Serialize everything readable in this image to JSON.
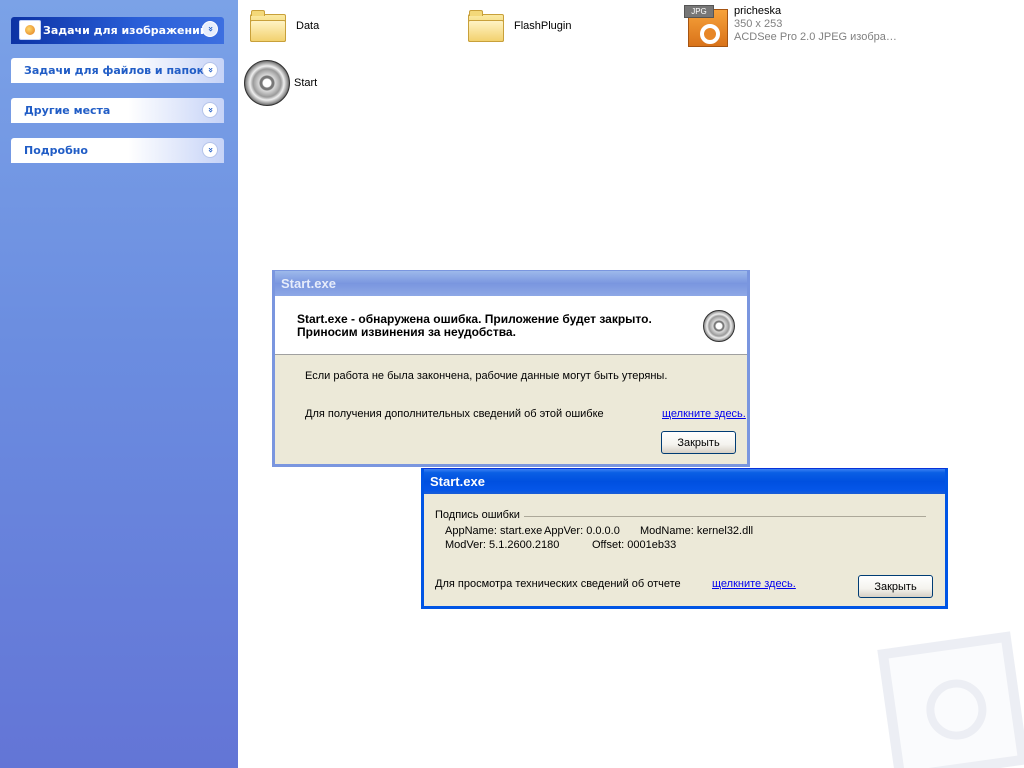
{
  "taskpane": {
    "panels": [
      {
        "label": "Задачи для изображений",
        "icon": "picture-tasks-icon"
      },
      {
        "label": "Задачи для файлов и папок"
      },
      {
        "label": "Другие места"
      },
      {
        "label": "Подробно"
      }
    ],
    "chevron_glyph": "»"
  },
  "files": {
    "data_folder": "Data",
    "flash_folder": "FlashPlugin",
    "start_exe": "Start",
    "jpg": {
      "tag": "JPG",
      "name": "pricheska",
      "dims": "350 x 253",
      "type": "ACDSee Pro 2.0 JPEG изобра…"
    }
  },
  "error_dialog": {
    "title": "Start.exe",
    "message_line1": "Start.exe - обнаружена ошибка. Приложение будет закрыто.",
    "message_line2": "Приносим извинения за неудобства.",
    "info": "Если работа не была закончена, рабочие данные могут быть утеряны.",
    "more_info": "Для получения дополнительных сведений об этой ошибке",
    "link": "щелкните здесь.",
    "close_button": "Закрыть"
  },
  "signature_dialog": {
    "title": "Start.exe",
    "group_label": "Подпись ошибки",
    "app_name": "AppName: start.exe",
    "app_ver": "AppVer: 0.0.0.0",
    "mod_name": "ModName: kernel32.dll",
    "mod_ver": "ModVer: 5.1.2600.2180",
    "offset": "Offset: 0001eb33",
    "tech_info": "Для просмотра технических сведений об отчете",
    "link": "щелкните здесь.",
    "close_button": "Закрыть"
  }
}
